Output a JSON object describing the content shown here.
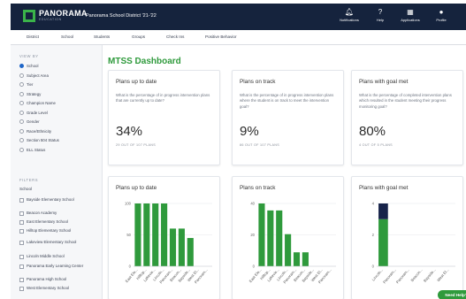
{
  "app": {
    "logo_name": "PANORAMA",
    "logo_sub": "EDUCATION",
    "district": "Panorama School District '21-'22"
  },
  "top_icons": [
    {
      "icon": "bell-icon",
      "glyph": "🔔︎",
      "label": "Notifications"
    },
    {
      "icon": "help-icon",
      "glyph": "?",
      "label": "Help"
    },
    {
      "icon": "apps-grid-icon",
      "glyph": "▦",
      "label": "Applications"
    },
    {
      "icon": "profile-icon",
      "glyph": "●",
      "label": "Profile"
    }
  ],
  "nav": [
    "District",
    "School",
    "Students",
    "Groups",
    "Check Ins",
    "Positive Behavior"
  ],
  "sidebar": {
    "view_by_heading": "VIEW BY",
    "view_by": [
      {
        "label": "School",
        "selected": true
      },
      {
        "label": "Subject Area",
        "selected": false
      },
      {
        "label": "Tier",
        "selected": false
      },
      {
        "label": "Strategy",
        "selected": false
      },
      {
        "label": "Champion Name",
        "selected": false
      },
      {
        "label": "Grade Level",
        "selected": false
      },
      {
        "label": "Gender",
        "selected": false
      },
      {
        "label": "Race/Ethnicity",
        "selected": false
      },
      {
        "label": "Section 504 Status",
        "selected": false
      },
      {
        "label": "ELL Status",
        "selected": false
      }
    ],
    "filters_heading": "FILTERS",
    "filter_group": "School",
    "schools": [
      "Bayside Elementary School",
      "Beacon Academy",
      "East Elementary School",
      "Hilltop Elementary School",
      "Lakeview Elementary School",
      "Lincoln Middle School",
      "Panorama Early Learning Center",
      "Panorama High School",
      "West Elementary School"
    ]
  },
  "main": {
    "title": "MTSS Dashboard",
    "stat_cards": [
      {
        "title": "Plans up to date",
        "description": "What is the percentage of in progress intervention plans that are currently up to date?",
        "value": "34%",
        "caption": "29 OUT OF 107 PLANS"
      },
      {
        "title": "Plans on track",
        "description": "What is the percentage of in progress intervention plans where the student is on track to meet the intervention goal?",
        "value": "9%",
        "caption": "86 OUT OF 107 PLANS"
      },
      {
        "title": "Plans with goal met",
        "description": "What is the percentage of completed intervention plans which resulted in the student meeting their progress monitoring goal?",
        "value": "80%",
        "caption": "4 OUT OF 5 PLANS"
      }
    ]
  },
  "chart_data": [
    {
      "type": "bar",
      "title": "Plans up to date",
      "categories": [
        "East Ele...",
        "Hilltop...",
        "Lakevie...",
        "Lincoln...",
        "Panoram...",
        "Beacon...",
        "Bayside...",
        "West El...",
        "Panoram..."
      ],
      "values": [
        100,
        100,
        100,
        100,
        60,
        60,
        45,
        0,
        0
      ],
      "ylim": [
        0,
        100
      ],
      "yticks": [
        "100",
        "50",
        "0"
      ],
      "color": "#2f9a3c"
    },
    {
      "type": "bar",
      "title": "Plans on track",
      "categories": [
        "East Ele...",
        "Hilltop...",
        "Lakevie...",
        "Lincoln...",
        "Panoram...",
        "Beacon...",
        "Bayside...",
        "West El...",
        "Panoram..."
      ],
      "values": [
        45,
        40,
        40,
        23,
        10,
        10,
        0,
        0,
        0
      ],
      "ylim": [
        0,
        45
      ],
      "yticks": [
        "40",
        "20",
        "0"
      ],
      "color": "#2f9a3c"
    },
    {
      "type": "bar",
      "stacked": true,
      "title": "Plans with goal met",
      "categories": [
        "Lincoln...",
        "Panoram...",
        "Panoram...",
        "Beacon...",
        "Bayside...",
        "West El..."
      ],
      "series": [
        {
          "values": [
            3,
            0,
            0,
            0,
            0,
            0
          ],
          "color": "#2f9a3c"
        },
        {
          "values": [
            1,
            0,
            0,
            0,
            0,
            0
          ],
          "color": "#17234a"
        }
      ],
      "ylim": [
        0,
        4
      ],
      "yticks": [
        "4",
        "2",
        "0"
      ]
    }
  ],
  "help_button": "Need Help?"
}
